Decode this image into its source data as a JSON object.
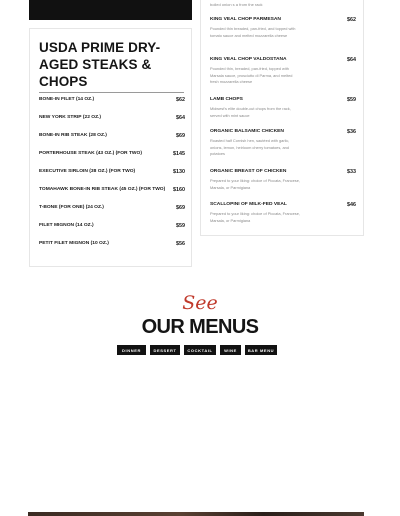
{
  "steaks": {
    "title": "USDA PRIME DRY-AGED STEAKS & CHOPS",
    "items": [
      {
        "name": "BONE-IN FILET (14 OZ.)",
        "price": "$62"
      },
      {
        "name": "NEW YORK STRIP (22 OZ.)",
        "price": "$64"
      },
      {
        "name": "BONE-IN RIB STEAK (28 OZ.)",
        "price": "$69"
      },
      {
        "name": "PORTERHOUSE STEAK (43 OZ.) (FOR TWO)",
        "price": "$145"
      },
      {
        "name": "EXECUTIVE SIRLOIN (38 OZ.) (FOR TWO)",
        "price": "$130"
      },
      {
        "name": "TOMAHAWK BONE-IN RIB STEAK (45 OZ.) (FOR TWO)",
        "price": "$160"
      },
      {
        "name": "T-BONE (FOR ONE) (24 OZ.)",
        "price": "$69"
      },
      {
        "name": "FILET MIGNON (14 OZ.)",
        "price": "$59"
      },
      {
        "name": "PETIT FILET MIGNON (10 OZ.)",
        "price": "$56"
      }
    ]
  },
  "chops": {
    "cut_text": "boiled onion s a from the rack",
    "items": [
      {
        "name": "KING VEAL CHOP PARMESAN",
        "price": "$62",
        "description": "Pounded thin breaded, pan-fried, and topped with tomato sauce and melted mozzarella cheese"
      },
      {
        "name": "KING VEAL CHOP VALDOSTANA",
        "price": "$64",
        "description": "Pounded thin, breaded, pan-fried, topped with Marsala sauce, prosciutto di Parma, and melted fresh mozzarella cheese"
      },
      {
        "name": "LAMB CHOPS",
        "price": "$59",
        "description": "Midwest's elite double-cut chops from the rack, served with mint sauce"
      },
      {
        "name": "ORGANIC BALSAMIC CHICKEN",
        "price": "$36",
        "description": "Roasted half Cornish hen, sautéed with garlic, onions, lemon, heirloom cherry tomatoes, and potatoes"
      },
      {
        "name": "ORGANIC BREAST OF CHICKEN",
        "price": "$33",
        "description": "Prepared to your liking: choice of Piccata, Francese, Marsala, or Parmigiana"
      },
      {
        "name": "SCALLOPINI OF MILK-FED VEAL",
        "price": "$46",
        "description": "Prepared to your liking: choice of Piccata, Francese, Marsala, or Parmigiana"
      }
    ]
  },
  "menus": {
    "script": "See",
    "heading": "OUR MENUS",
    "tabs": [
      {
        "label": "DINNER"
      },
      {
        "label": "DESSERT"
      },
      {
        "label": "COCKTAIL"
      },
      {
        "label": "WINE"
      },
      {
        "label": "BAR MENU"
      }
    ]
  },
  "colors": {
    "accent": "#c0392b",
    "tab_bg": "#121212"
  }
}
